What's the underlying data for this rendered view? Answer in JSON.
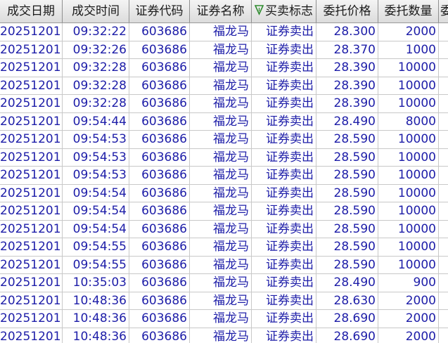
{
  "table": {
    "headers": [
      "成交日期",
      "成交时间",
      "证券代码",
      "证券名称",
      "买卖标志",
      "委托价格",
      "委托数量",
      "委"
    ],
    "sorted_column_icon": "filter-triangle-icon",
    "rows": [
      [
        "20251201",
        "09:32:22",
        "603686",
        "福龙马",
        "证券卖出",
        "28.300",
        "2000"
      ],
      [
        "20251201",
        "09:32:26",
        "603686",
        "福龙马",
        "证券卖出",
        "28.370",
        "1000"
      ],
      [
        "20251201",
        "09:32:28",
        "603686",
        "福龙马",
        "证券卖出",
        "28.390",
        "10000"
      ],
      [
        "20251201",
        "09:32:28",
        "603686",
        "福龙马",
        "证券卖出",
        "28.390",
        "10000"
      ],
      [
        "20251201",
        "09:32:28",
        "603686",
        "福龙马",
        "证券卖出",
        "28.390",
        "10000"
      ],
      [
        "20251201",
        "09:54:44",
        "603686",
        "福龙马",
        "证券卖出",
        "28.490",
        "8000"
      ],
      [
        "20251201",
        "09:54:53",
        "603686",
        "福龙马",
        "证券卖出",
        "28.590",
        "10000"
      ],
      [
        "20251201",
        "09:54:53",
        "603686",
        "福龙马",
        "证券卖出",
        "28.590",
        "10000"
      ],
      [
        "20251201",
        "09:54:53",
        "603686",
        "福龙马",
        "证券卖出",
        "28.590",
        "10000"
      ],
      [
        "20251201",
        "09:54:54",
        "603686",
        "福龙马",
        "证券卖出",
        "28.590",
        "10000"
      ],
      [
        "20251201",
        "09:54:54",
        "603686",
        "福龙马",
        "证券卖出",
        "28.590",
        "10000"
      ],
      [
        "20251201",
        "09:54:54",
        "603686",
        "福龙马",
        "证券卖出",
        "28.590",
        "10000"
      ],
      [
        "20251201",
        "09:54:55",
        "603686",
        "福龙马",
        "证券卖出",
        "28.590",
        "10000"
      ],
      [
        "20251201",
        "09:54:55",
        "603686",
        "福龙马",
        "证券卖出",
        "28.590",
        "10000"
      ],
      [
        "20251201",
        "10:35:03",
        "603686",
        "福龙马",
        "证券卖出",
        "28.490",
        "900"
      ],
      [
        "20251201",
        "10:48:36",
        "603686",
        "福龙马",
        "证券卖出",
        "28.630",
        "2000"
      ],
      [
        "20251201",
        "10:48:36",
        "603686",
        "福龙马",
        "证券卖出",
        "28.690",
        "2000"
      ],
      [
        "20251201",
        "10:48:36",
        "603686",
        "福龙马",
        "证券卖出",
        "28.690",
        "2000"
      ]
    ]
  },
  "colors": {
    "header_bg": "#e6e6e6",
    "cell_text": "#1d1da8",
    "sort_icon": "#2e8b2e"
  }
}
